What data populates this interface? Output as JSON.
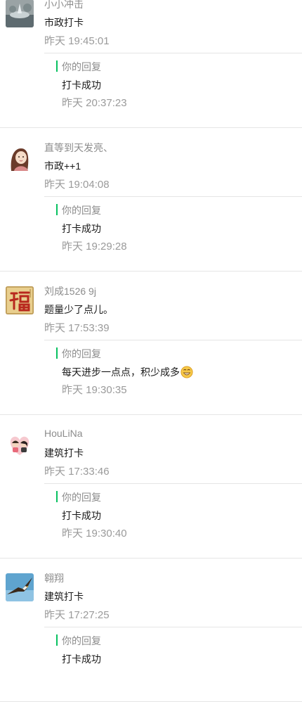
{
  "reply_label": "你的回复",
  "accent_color": "#07c160",
  "comments": [
    {
      "name": "小小冲击",
      "message": "市政打卡",
      "time": "昨天 19:45:01",
      "reply": "打卡成功",
      "reply_time": "昨天 20:37:23",
      "avatar": "fountain-avatar"
    },
    {
      "name": "直等到天发亮、",
      "message": "市政++1",
      "time": "昨天 19:04:08",
      "reply": "打卡成功",
      "reply_time": "昨天 19:29:28",
      "avatar": "girl-illustration-avatar"
    },
    {
      "name": "刘成1526 9j",
      "message": "题量少了点儿。",
      "time": "昨天 17:53:39",
      "reply": "每天进步一点点，积少成多",
      "reply_emoji": "grin-emoji-icon",
      "reply_time": "昨天 19:30:35",
      "avatar": "fu-character-avatar"
    },
    {
      "name": "HouLiNa",
      "message": "建筑打卡",
      "time": "昨天 17:33:46",
      "reply": "打卡成功",
      "reply_time": "昨天 19:30:40",
      "avatar": "couple-cartoon-avatar"
    },
    {
      "name": "翱翔",
      "message": "建筑打卡",
      "time": "昨天 17:27:25",
      "reply": "打卡成功",
      "reply_time": "",
      "avatar": "eagle-avatar"
    }
  ]
}
